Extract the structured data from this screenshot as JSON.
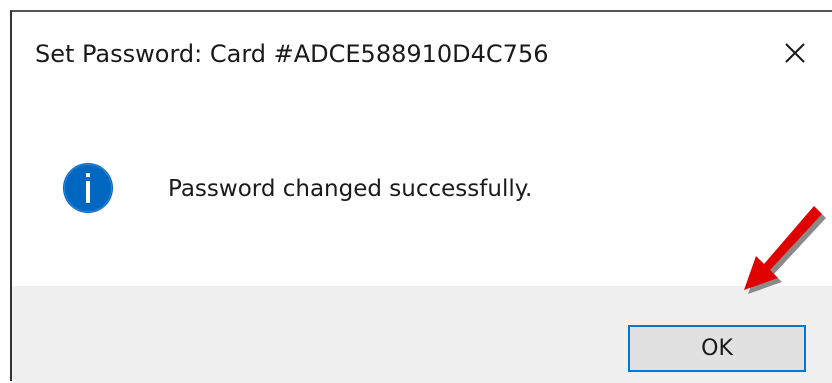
{
  "dialog": {
    "title": "Set Password: Card #ADCE588910D4C756",
    "close_icon": "close-icon",
    "info_icon": "info-icon",
    "message": "Password changed successfully.",
    "ok_label": "OK"
  },
  "annotation": {
    "arrow_icon": "red-arrow-icon",
    "arrow_color": "#e00000"
  },
  "colors": {
    "info_blue": "#0067c0",
    "focus_border": "#0078d7",
    "footer_bg": "#f0f0f0"
  }
}
